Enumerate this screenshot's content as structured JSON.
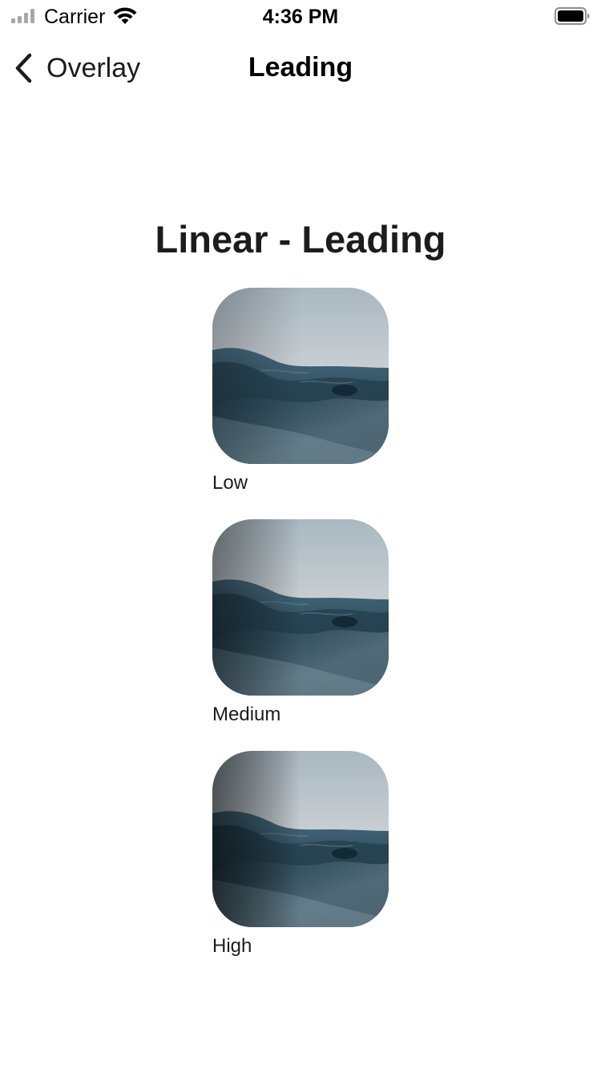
{
  "status_bar": {
    "carrier": "Carrier",
    "time": "4:36 PM",
    "icons": [
      "signal-icon",
      "wifi-icon",
      "battery-icon"
    ]
  },
  "nav": {
    "back_label": "Overlay",
    "back_icon": "chevron-left-icon",
    "title": "Leading"
  },
  "content": {
    "title": "Linear - Leading",
    "items": [
      {
        "label": "Low"
      },
      {
        "label": "Medium"
      },
      {
        "label": "High"
      }
    ]
  },
  "colors": {
    "sky_top": "#aebcc4",
    "sky_horizon": "#e6d3d0",
    "water_light": "#3e5f72",
    "water_dark": "#17303d"
  }
}
